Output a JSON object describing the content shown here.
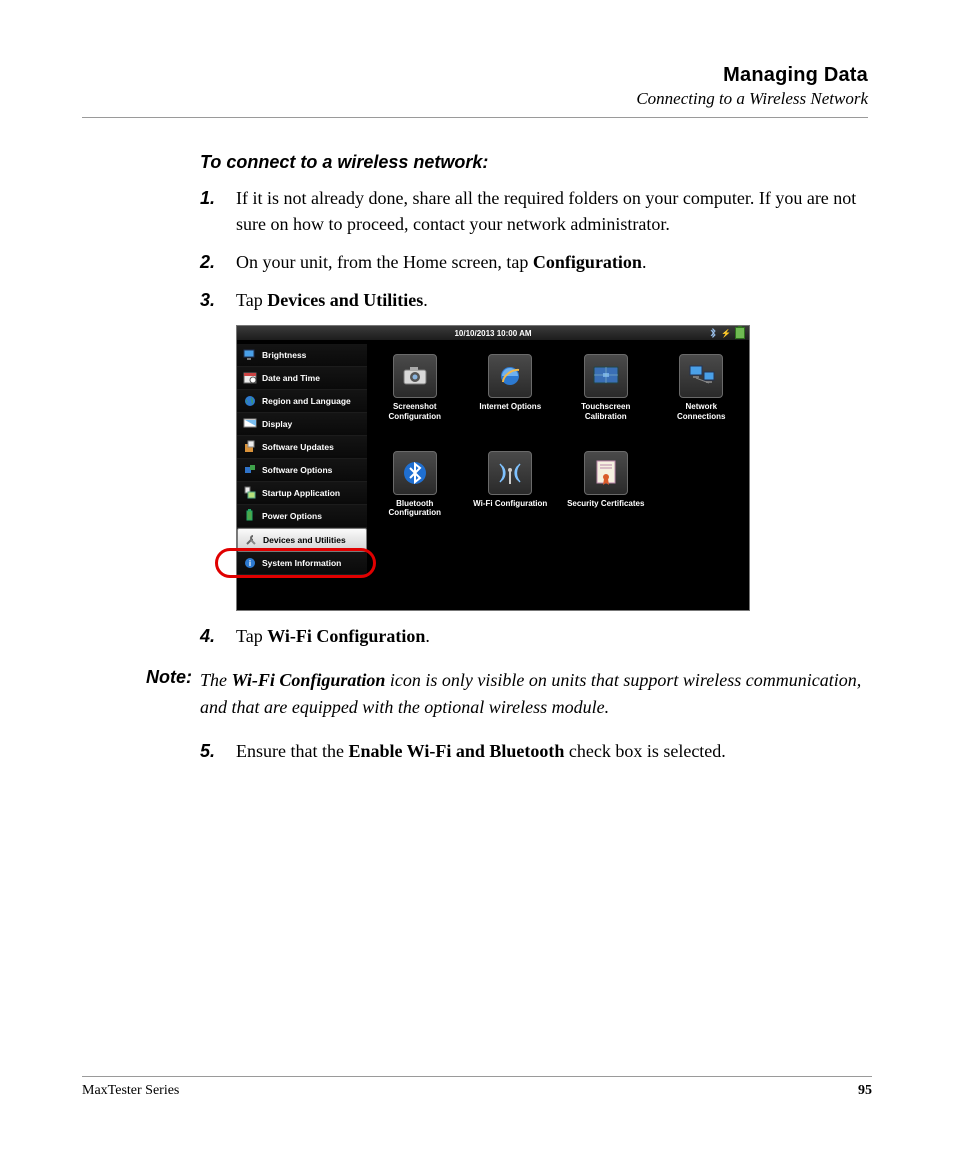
{
  "header": {
    "chapter": "Managing Data",
    "subtitle": "Connecting to a Wireless Network"
  },
  "intro": "To connect to a wireless network:",
  "steps": {
    "s1": {
      "num": "1.",
      "text": "If it is not already done, share all the required folders on your computer. If you are not sure on how to proceed, contact your network administrator."
    },
    "s2": {
      "num": "2.",
      "pre": "On your unit, from the Home screen, tap ",
      "bold": "Configuration",
      "post": "."
    },
    "s3": {
      "num": "3.",
      "pre": "Tap ",
      "bold": "Devices and Utilities",
      "post": "."
    },
    "s4": {
      "num": "4.",
      "pre": "Tap ",
      "bold": "Wi-Fi Configuration",
      "post": "."
    },
    "s5": {
      "num": "5.",
      "pre": "Ensure that the ",
      "bold": "Enable Wi-Fi and Bluetooth",
      "post": " check box is selected."
    }
  },
  "note": {
    "label": "Note:",
    "pre": "The ",
    "bold": "Wi-Fi Configuration",
    "post": " icon is only visible on units that support wireless communication, and that are equipped with the optional wireless module."
  },
  "screenshot": {
    "clock": "10/10/2013 10:00 AM",
    "sidebar": [
      "Brightness",
      "Date and Time",
      "Region and Language",
      "Display",
      "Software Updates",
      "Software Options",
      "Startup Application",
      "Power Options",
      "Devices and Utilities",
      "System Information"
    ],
    "selected_index": 8,
    "tiles": [
      "Screenshot Configuration",
      "Internet Options",
      "Touchscreen Calibration",
      "Network Connections",
      "Bluetooth Configuration",
      "Wi-Fi Configuration",
      "Security Certificates"
    ]
  },
  "footer": {
    "series": "MaxTester Series",
    "page": "95"
  }
}
